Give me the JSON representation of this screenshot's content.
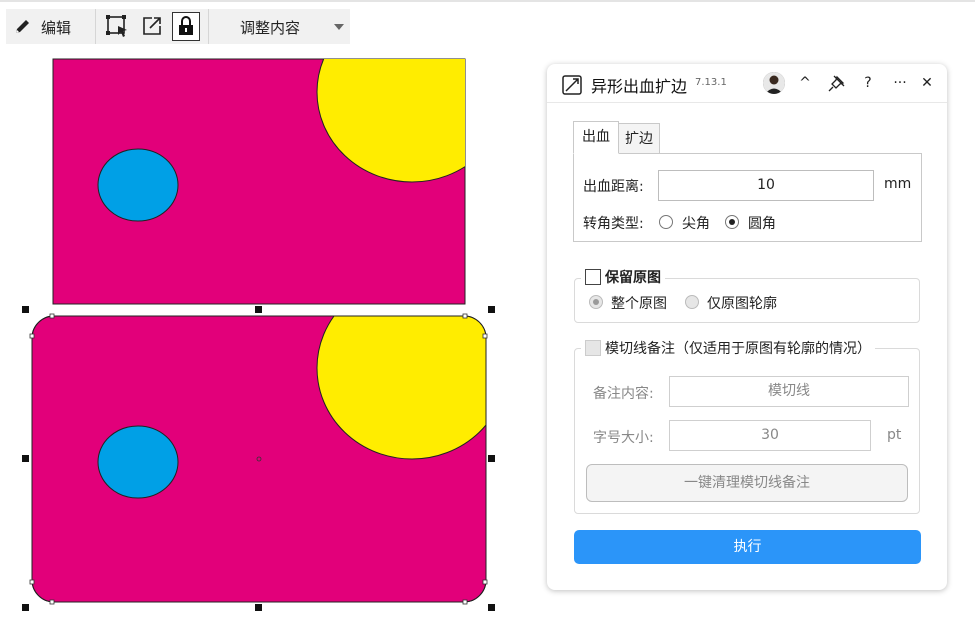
{
  "toolbar": {
    "edit_label": "编辑",
    "adjust_label": "调整内容"
  },
  "panel": {
    "title": "异形出血扩边",
    "version": "7.13.1",
    "header_buttons": {
      "collapse": "^",
      "help": "?",
      "more": "···",
      "close": "✕"
    },
    "tabs": [
      {
        "label": "出血",
        "active": true
      },
      {
        "label": "扩边",
        "active": false
      }
    ],
    "bleed": {
      "distance_label": "出血距离:",
      "distance_value": "10",
      "distance_unit": "mm",
      "corner_label": "转角类型:",
      "corner_options": [
        {
          "label": "尖角",
          "selected": false
        },
        {
          "label": "圆角",
          "selected": true
        }
      ]
    },
    "keep_original": {
      "label": "保留原图",
      "checked": false,
      "options": [
        {
          "label": "整个原图",
          "selected": true
        },
        {
          "label": "仅原图轮廓",
          "selected": false
        }
      ]
    },
    "die_line_note": {
      "label": "模切线备注（仅适用于原图有轮廓的情况）",
      "checked": false,
      "content_label": "备注内容:",
      "content_value": "模切线",
      "size_label": "字号大小:",
      "size_value": "30",
      "size_unit": "pt",
      "clean_button": "一键清理模切线备注"
    },
    "execute_button": "执行"
  },
  "colors": {
    "magenta": "#e2007a",
    "yellow": "#ffed00",
    "cyan": "#00a0e6",
    "accent": "#2b95f9"
  }
}
